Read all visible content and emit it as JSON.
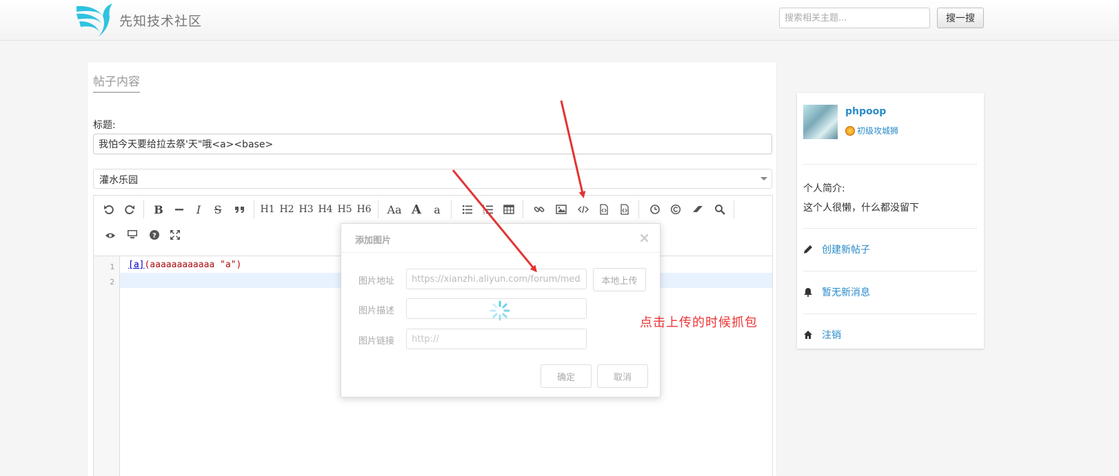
{
  "header": {
    "site_name": "先知技术社区",
    "search_placeholder": "搜索相关主题...",
    "search_button": "搜一搜"
  },
  "form": {
    "tab_label": "帖子内容",
    "title_label": "标题:",
    "title_value": "我怕今天要给拉去祭'天\"哦<a><base>",
    "category_selected": "灌水乐园"
  },
  "editor": {
    "toolbar_text_buttons": [
      "H1",
      "H2",
      "H3",
      "H4",
      "H5",
      "H6",
      "Aa",
      "A",
      "a"
    ],
    "line_numbers": [
      "1",
      "2"
    ],
    "code_link": "[a]",
    "code_rest": "(aaaaaaaaaaaa \"a\")"
  },
  "modal": {
    "title": "添加图片",
    "close": "×",
    "image_url_label": "图片地址",
    "image_url_value": "https://xianzhi.aliyun.com/forum/media/u",
    "image_desc_label": "图片描述",
    "image_desc_value": "",
    "image_link_label": "图片链接",
    "image_link_placeholder": "http://",
    "local_upload": "本地上传",
    "confirm": "确定",
    "cancel": "取消"
  },
  "annotation": {
    "text": "点击上传的时候抓包",
    "color": "#e33333"
  },
  "sidebar": {
    "username": "phpoop",
    "rank": "初级攻城狮",
    "bio_label": "个人简介:",
    "bio_text": "这个人很懒，什么都没留下",
    "links": {
      "create_post": "创建新帖子",
      "no_messages": "暂无新消息",
      "logout": "注销"
    }
  },
  "colors": {
    "link": "#2a8bc9",
    "logo": "#2fc3e0"
  }
}
